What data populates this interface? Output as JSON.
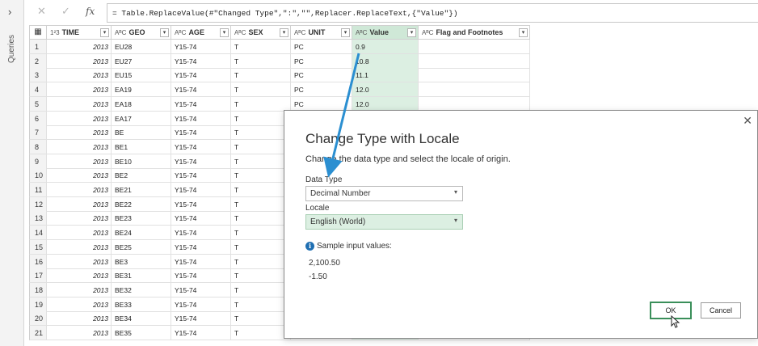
{
  "sidebar": {
    "label": "Queries",
    "expand_glyph": "›"
  },
  "formula_bar": {
    "cancel_glyph": "✕",
    "check_glyph": "✓",
    "fx_glyph": "fx",
    "formula": "= Table.ReplaceValue(#\"Changed Type\",\":\",\"\",Replacer.ReplaceText,{\"Value\"})"
  },
  "table": {
    "corner_glyph": "▦",
    "columns": [
      {
        "type_icon": "1²3",
        "name": "TIME"
      },
      {
        "type_icon": "AᴮC",
        "name": "GEO"
      },
      {
        "type_icon": "AᴮC",
        "name": "AGE"
      },
      {
        "type_icon": "AᴮC",
        "name": "SEX"
      },
      {
        "type_icon": "AᴮC",
        "name": "UNIT"
      },
      {
        "type_icon": "AᴮC",
        "name": "Value"
      },
      {
        "type_icon": "AᴮC",
        "name": "Flag and Footnotes"
      }
    ],
    "dropdown_glyph": "▾",
    "rows": [
      [
        "1",
        "2013",
        "EU28",
        "Y15-74",
        "T",
        "PC",
        "0.9",
        ""
      ],
      [
        "2",
        "2013",
        "EU27",
        "Y15-74",
        "T",
        "PC",
        "10.8",
        ""
      ],
      [
        "3",
        "2013",
        "EU15",
        "Y15-74",
        "T",
        "PC",
        "11.1",
        ""
      ],
      [
        "4",
        "2013",
        "EA19",
        "Y15-74",
        "T",
        "PC",
        "12.0",
        ""
      ],
      [
        "5",
        "2013",
        "EA18",
        "Y15-74",
        "T",
        "PC",
        "12.0",
        ""
      ],
      [
        "6",
        "2013",
        "EA17",
        "Y15-74",
        "T",
        "",
        ""
      ],
      [
        "7",
        "2013",
        "BE",
        "Y15-74",
        "T",
        "",
        ""
      ],
      [
        "8",
        "2013",
        "BE1",
        "Y15-74",
        "T",
        "",
        ""
      ],
      [
        "9",
        "2013",
        "BE10",
        "Y15-74",
        "T",
        "",
        ""
      ],
      [
        "10",
        "2013",
        "BE2",
        "Y15-74",
        "T",
        "",
        ""
      ],
      [
        "11",
        "2013",
        "BE21",
        "Y15-74",
        "T",
        "",
        ""
      ],
      [
        "12",
        "2013",
        "BE22",
        "Y15-74",
        "T",
        "",
        ""
      ],
      [
        "13",
        "2013",
        "BE23",
        "Y15-74",
        "T",
        "",
        ""
      ],
      [
        "14",
        "2013",
        "BE24",
        "Y15-74",
        "T",
        "",
        ""
      ],
      [
        "15",
        "2013",
        "BE25",
        "Y15-74",
        "T",
        "",
        ""
      ],
      [
        "16",
        "2013",
        "BE3",
        "Y15-74",
        "T",
        "",
        ""
      ],
      [
        "17",
        "2013",
        "BE31",
        "Y15-74",
        "T",
        "",
        ""
      ],
      [
        "18",
        "2013",
        "BE32",
        "Y15-74",
        "T",
        "",
        ""
      ],
      [
        "19",
        "2013",
        "BE33",
        "Y15-74",
        "T",
        "",
        ""
      ],
      [
        "20",
        "2013",
        "BE34",
        "Y15-74",
        "T",
        "",
        ""
      ],
      [
        "21",
        "2013",
        "BE35",
        "Y15-74",
        "T",
        "",
        ""
      ]
    ]
  },
  "dialog": {
    "close_glyph": "✕",
    "title": "Change Type with Locale",
    "description": "Change the data type and select the locale of origin.",
    "data_type_label": "Data Type",
    "data_type_value": "Decimal Number",
    "locale_label": "Locale",
    "locale_value": "English (World)",
    "select_arrow": "▾",
    "info_glyph": "i",
    "sample_label": "Sample input values:",
    "samples": [
      "2,100.50",
      "-1.50"
    ],
    "ok_label": "OK",
    "cancel_label": "Cancel"
  },
  "colors": {
    "accent_green": "#dcefe2",
    "arrow_blue": "#2b8fd1",
    "info_blue": "#1f6fb2"
  }
}
